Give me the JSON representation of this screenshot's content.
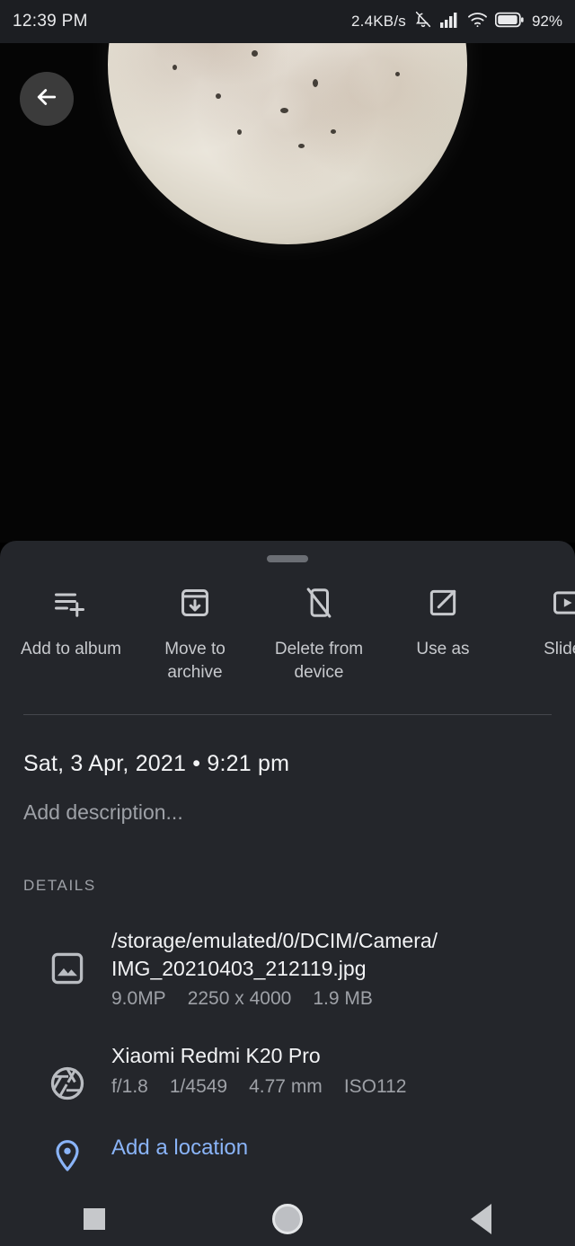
{
  "status_bar": {
    "time": "12:39 PM",
    "network_speed": "2.4KB/s",
    "battery_percent": "92%",
    "icons": [
      "notifications-off-icon",
      "signal-bars-icon",
      "wifi-icon",
      "battery-icon"
    ]
  },
  "viewer": {
    "back_label": "Back",
    "photo_subject": "moon"
  },
  "actions": [
    {
      "label": "Add to album",
      "icon": "playlist-add-icon"
    },
    {
      "label": "Move to\narchive",
      "icon": "archive-icon"
    },
    {
      "label": "Delete from\ndevice",
      "icon": "phone-off-icon"
    },
    {
      "label": "Use as",
      "icon": "open-in-new-icon"
    },
    {
      "label": "Slides",
      "icon": "slideshow-icon"
    }
  ],
  "info": {
    "datetime": "Sat, 3 Apr, 2021  •  9:21 pm",
    "description_placeholder": "Add description..."
  },
  "details": {
    "header": "DETAILS",
    "file": {
      "path_line1": "/storage/emulated/0/DCIM/Camera/",
      "path_line2": "IMG_20210403_212119.jpg",
      "megapixels": "9.0MP",
      "dimensions": "2250 x 4000",
      "size": "1.9 MB"
    },
    "camera": {
      "model": "Xiaomi Redmi K20 Pro",
      "aperture": "f/1.8",
      "shutter": "1/4549",
      "focal_length": "4.77 mm",
      "iso": "ISO112"
    },
    "location": {
      "add_label": "Add a location",
      "icon": "location-pin-icon",
      "color": "#8ab4f8"
    }
  },
  "nav_bar": {
    "recents_label": "Recents",
    "home_label": "Home",
    "back_label": "Back"
  },
  "colors": {
    "sheet_background": "#24262b",
    "status_bar_background": "#1c1e22",
    "accent_blue": "#8ab4f8",
    "primary_text": "#f2f3f5",
    "secondary_text": "#9ea1a7"
  }
}
